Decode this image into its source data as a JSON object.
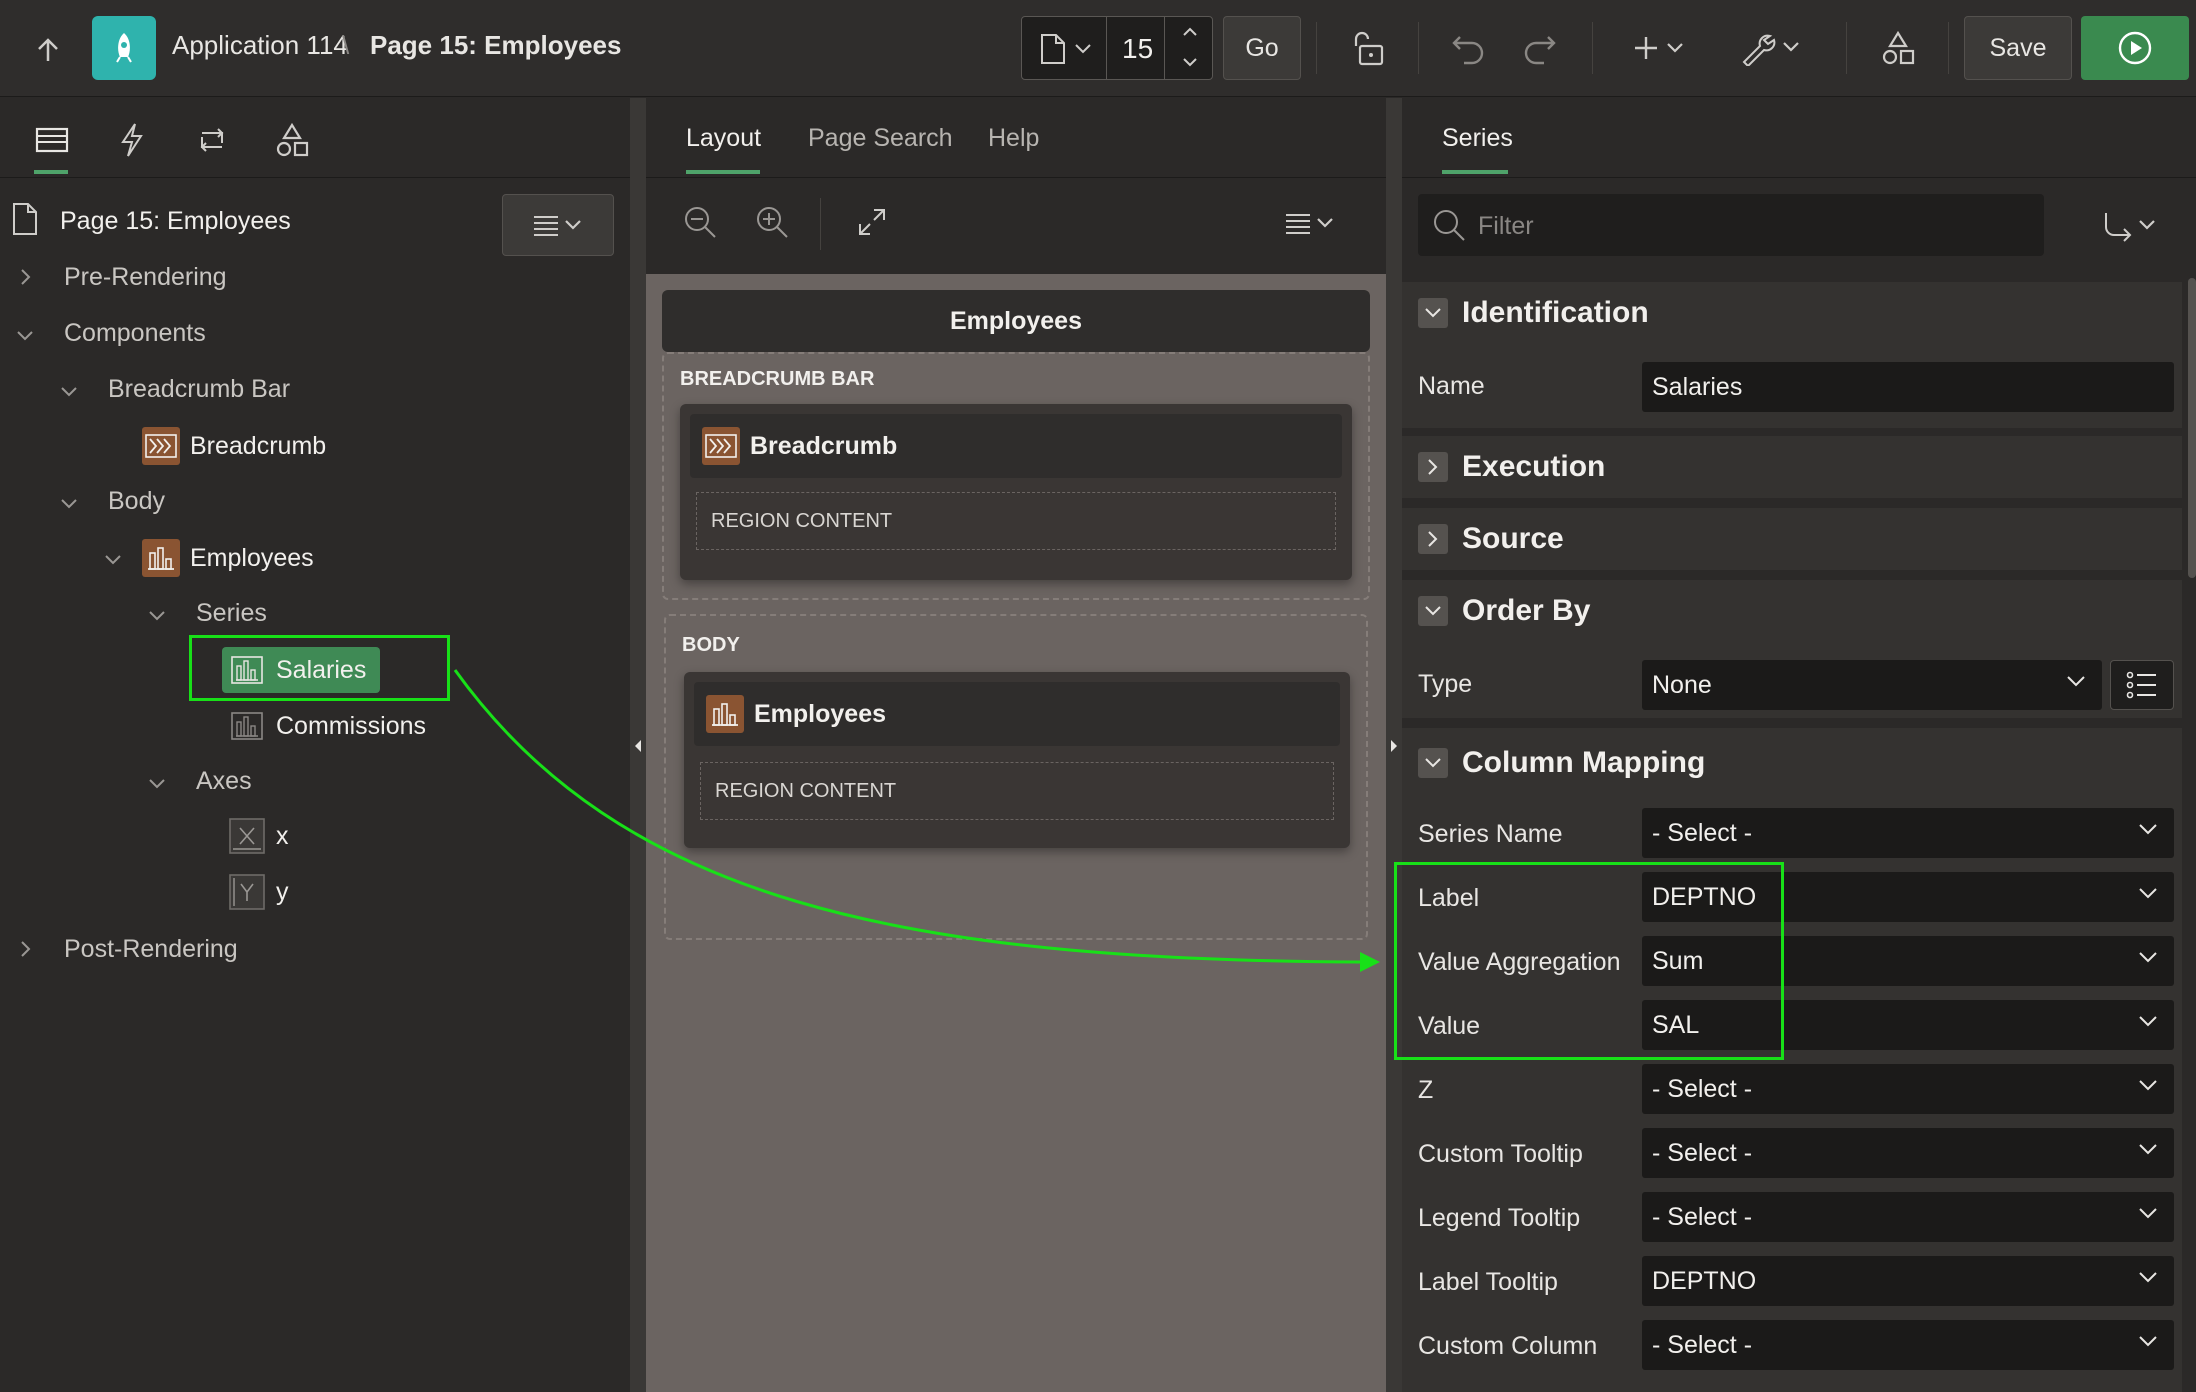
{
  "header": {
    "app_name": "Application 114",
    "separator": "\\",
    "page_title": "Page 15: Employees",
    "page_number": "15",
    "go_label": "Go",
    "save_label": "Save"
  },
  "left_panel": {
    "tabs": [
      "rendering-tab",
      "dynamic-actions-tab",
      "processing-tab",
      "shared-components-tab"
    ],
    "root_label": "Page 15: Employees",
    "tree": {
      "pre_rendering": "Pre-Rendering",
      "components": "Components",
      "breadcrumb_bar": "Breadcrumb Bar",
      "breadcrumb": "Breadcrumb",
      "body": "Body",
      "employees": "Employees",
      "series": "Series",
      "salaries": "Salaries",
      "commissions": "Commissions",
      "axes": "Axes",
      "axis_x": "x",
      "axis_y": "y",
      "post_rendering": "Post-Rendering"
    }
  },
  "middle_panel": {
    "tabs": [
      "Layout",
      "Page Search",
      "Help"
    ],
    "active_tab": "Layout",
    "page_region_title": "Employees",
    "breadcrumb_bar_label": "BREADCRUMB BAR",
    "breadcrumb_card_title": "Breadcrumb",
    "region_content_1": "REGION CONTENT",
    "body_label": "BODY",
    "employees_card_title": "Employees",
    "region_content_2": "REGION CONTENT"
  },
  "right_panel": {
    "tab": "Series",
    "filter_placeholder": "Filter",
    "sections": {
      "identification": "Identification",
      "execution": "Execution",
      "source": "Source",
      "order_by": "Order By",
      "column_mapping": "Column Mapping"
    },
    "identification": {
      "name_label": "Name",
      "name_value": "Salaries"
    },
    "order_by": {
      "type_label": "Type",
      "type_value": "None"
    },
    "column_mapping": [
      {
        "label": "Series Name",
        "value": "- Select -"
      },
      {
        "label": "Label",
        "value": "DEPTNO"
      },
      {
        "label": "Value Aggregation",
        "value": "Sum"
      },
      {
        "label": "Value",
        "value": "SAL"
      },
      {
        "label": "Z",
        "value": "- Select -"
      },
      {
        "label": "Custom Tooltip",
        "value": "- Select -"
      },
      {
        "label": "Legend Tooltip",
        "value": "- Select -"
      },
      {
        "label": "Label Tooltip",
        "value": "DEPTNO"
      },
      {
        "label": "Custom Column",
        "value": "- Select -"
      }
    ]
  },
  "colors": {
    "highlight": "#18e018",
    "accent_green": "#4fa36a",
    "run_button": "#3a8a4f",
    "app_icon": "#2fb3ad",
    "region_icon": "#8a5432"
  }
}
